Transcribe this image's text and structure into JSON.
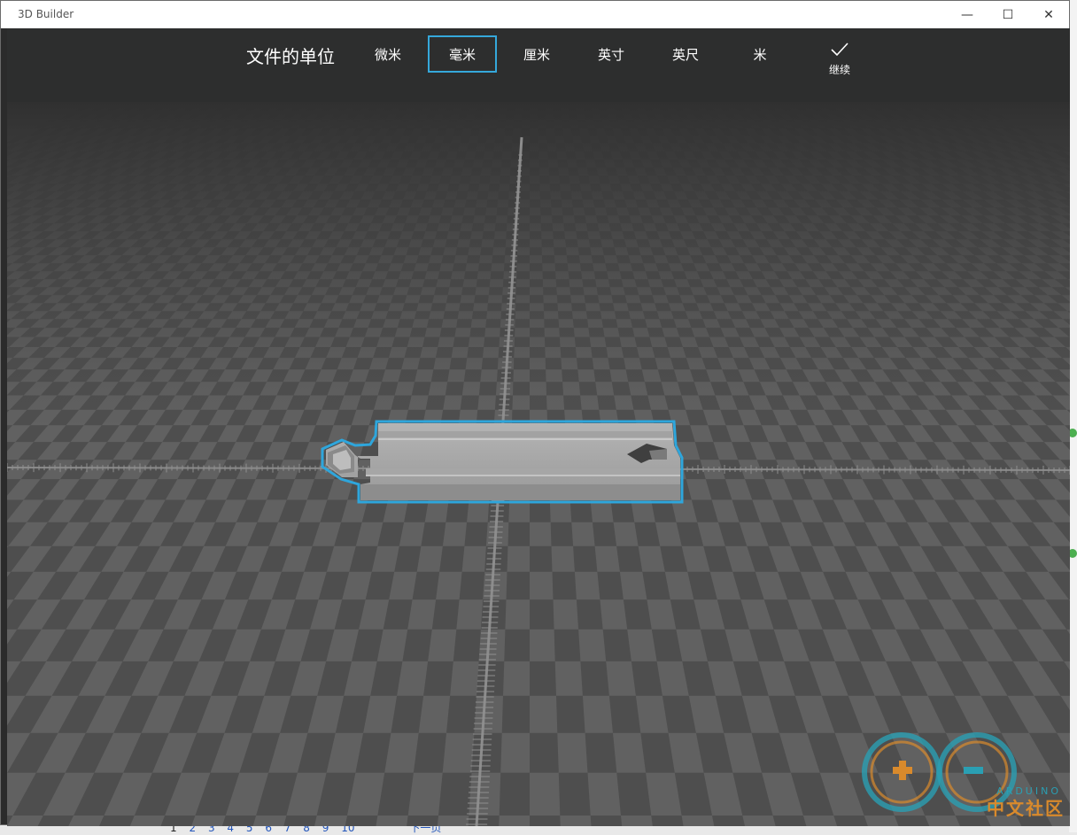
{
  "window": {
    "title": "3D Builder",
    "minimize_glyph": "—",
    "maximize_glyph": "☐",
    "close_glyph": "✕"
  },
  "toolbar": {
    "title": "文件的单位",
    "units": [
      "微米",
      "毫米",
      "厘米",
      "英寸",
      "英尺",
      "米"
    ],
    "selected_unit": "毫米",
    "continue_label": "继续"
  },
  "colors": {
    "accent": "#35a8db",
    "toolbar_bg": "#2d2e2e",
    "floor_light": "#616161",
    "floor_dark": "#4e4e4e"
  },
  "background_app": {
    "pager_pages": [
      "1",
      "2",
      "3",
      "4",
      "5",
      "6",
      "7",
      "8",
      "9",
      "10"
    ],
    "pager_next": "下一页"
  },
  "watermark": {
    "brand": "ARDUINO",
    "text": "中文社区"
  }
}
